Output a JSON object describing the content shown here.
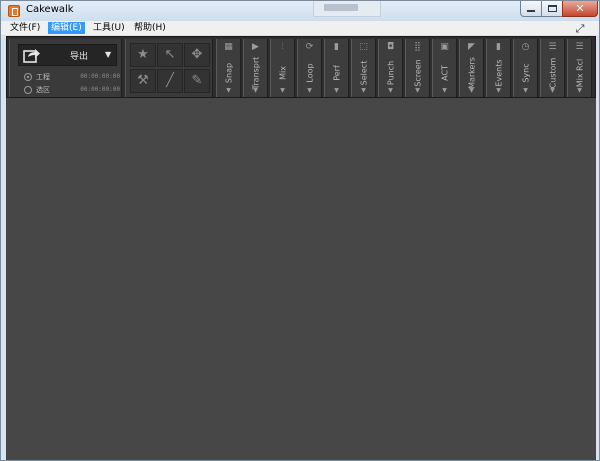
{
  "window": {
    "title": "Cakewalk",
    "app_icon": "cakewalk-app-icon",
    "controls": {
      "minimize": "minimize-icon",
      "maximize": "maximize-icon",
      "close_glyph": "✕"
    }
  },
  "menu": {
    "items": [
      {
        "label": "文件(F)",
        "active": false
      },
      {
        "label": "编辑(E)",
        "active": true
      },
      {
        "label": "工具(U)",
        "active": false
      },
      {
        "label": "帮助(H)",
        "active": false
      }
    ],
    "expand_glyph": "⤢"
  },
  "export": {
    "label": "导出",
    "arrow": "▼",
    "options": [
      {
        "label": "工程",
        "time": "00:00:00:00",
        "selected": true
      },
      {
        "label": "选区",
        "time": "00:00:00:00",
        "selected": false
      }
    ]
  },
  "tools": [
    {
      "name": "smart-tool",
      "glyph": "★"
    },
    {
      "name": "select-tool",
      "glyph": "↖"
    },
    {
      "name": "move-tool",
      "glyph": "✥"
    },
    {
      "name": "edit-tool",
      "glyph": "⚒"
    },
    {
      "name": "draw-tool",
      "glyph": "╱"
    },
    {
      "name": "erase-tool",
      "glyph": "✎"
    }
  ],
  "modules": [
    {
      "label": "Snap",
      "icon": "▦"
    },
    {
      "label": "Transprt",
      "icon": "▶"
    },
    {
      "label": "Mix",
      "icon": "⫶"
    },
    {
      "label": "Loop",
      "icon": "⟳"
    },
    {
      "label": "Perf",
      "icon": "▮"
    },
    {
      "label": "Select",
      "icon": "⬚"
    },
    {
      "label": "Punch",
      "icon": "◘"
    },
    {
      "label": "Screen",
      "icon": "⣿"
    },
    {
      "label": "ACT",
      "icon": "▣"
    },
    {
      "label": "Markers",
      "icon": "◤"
    },
    {
      "label": "Events",
      "icon": "▮"
    },
    {
      "label": "Sync",
      "icon": "◷"
    },
    {
      "label": "Custom",
      "icon": "☰"
    },
    {
      "label": "Mix Rcl",
      "icon": "☰"
    }
  ],
  "colors": {
    "titlebar": "#d7e4f2",
    "menu_highlight": "#3399ff",
    "controlbar": "#2e2e2e",
    "workspace": "#474747"
  }
}
